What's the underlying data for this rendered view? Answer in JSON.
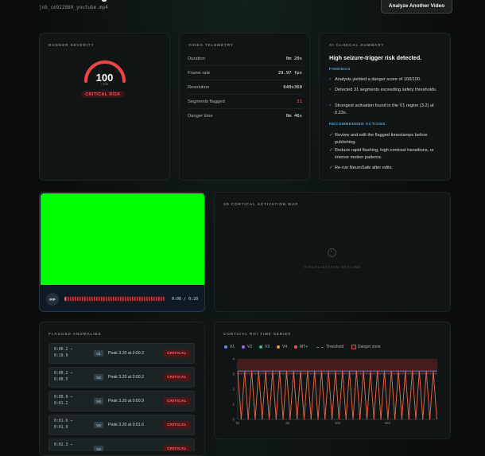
{
  "header": {
    "job_id": "job_ce922889_youtube.mp4",
    "analyze_button": "Analyze Another Video"
  },
  "severity": {
    "label": "DANGER SEVERITY",
    "score": "100",
    "max": "/ 100",
    "score_value": 100,
    "risk_badge": "CRITICAL RISK",
    "gauge_color": "#ef4444"
  },
  "telemetry": {
    "label": "VIDEO TELEMETRY",
    "rows": [
      {
        "key": "Duration",
        "value": "0m 20s"
      },
      {
        "key": "Frame rate",
        "value": "29.97 fps"
      },
      {
        "key": "Resolution",
        "value": "640x360"
      },
      {
        "key": "Segments flagged",
        "value": "31"
      },
      {
        "key": "Danger time",
        "value": "0m 46s"
      }
    ]
  },
  "summary": {
    "label": "AI CLINICAL SUMMARY",
    "headline": "High seizure-trigger risk detected.",
    "findings_label": "FINDINGS",
    "findings": [
      "Analysis yielded a danger score of 100/100.",
      "Detected 31 segments exceeding safety thresholds.",
      "Strongest activation found in the V1 region (3.2) at 0.23s."
    ],
    "actions_label": "RECOMMENDED ACTIONS",
    "actions": [
      "Review and edit the flagged timestamps before publishing.",
      "Reduce rapid flashing, high-contrast transitions, or intense motion patterns.",
      "Re-run NeuroSafe after edits."
    ]
  },
  "player": {
    "play_pause": "P/P",
    "time": "0:00 / 0:20",
    "progress": 0,
    "video_color": "#00ff00"
  },
  "cortical_map": {
    "label": "3D CORTICAL ACTIVATION MAP",
    "status": "VISUALIZATION OFFLINE"
  },
  "anomalies": {
    "label": "FLAGGED ANOMALIES",
    "items": [
      {
        "time": "0:00.2 → 0:19.9",
        "roi": "V1",
        "peak": "Peak 3.20 at 0:00.2",
        "badge": "CRITICAL"
      },
      {
        "time": "0:00.2 → 0:00.5",
        "roi": "V4",
        "peak": "Peak 3.20 at 0:00.2",
        "badge": "CRITICAL"
      },
      {
        "time": "0:00.9 → 0:01.2",
        "roi": "V4",
        "peak": "Peak 3.20 at 0:00.9",
        "badge": "CRITICAL"
      },
      {
        "time": "0:01.6 → 0:01.9",
        "roi": "V4",
        "peak": "Peak 3.20 at 0:01.6",
        "badge": "CRITICAL"
      },
      {
        "time": "0:02.3 →",
        "roi": "V4",
        "peak": "",
        "badge": "CRITICAL"
      }
    ]
  },
  "timeseries": {
    "label": "CORTICAL ROI TIME SERIES",
    "legend": [
      {
        "name": "V1",
        "color": "#4f8ff7"
      },
      {
        "name": "V2",
        "color": "#9b6cf0"
      },
      {
        "name": "V3",
        "color": "#2fc08b"
      },
      {
        "name": "V4",
        "color": "#f0a030"
      },
      {
        "name": "MT+",
        "color": "#e05a4a"
      },
      {
        "name": "Threshold",
        "color": "#6b7374"
      },
      {
        "name": "Danger zone",
        "color": "#d64545"
      }
    ]
  },
  "chart_data": {
    "type": "line",
    "title": "",
    "xlabel": "",
    "ylabel": "",
    "xlim": [
      0,
      20
    ],
    "ylim": [
      0,
      4
    ],
    "x_ticks": [
      "0s",
      "5s",
      "10s",
      "15s"
    ],
    "x_tick_values": [
      0,
      5,
      10,
      15
    ],
    "y_ticks": [
      "0",
      "1",
      "2",
      "3",
      "4"
    ],
    "threshold": 3,
    "grid": true,
    "legend_position": "top-left",
    "series": [
      {
        "name": "V1",
        "color": "#4f8ff7",
        "pattern": "flat",
        "level": 3.2
      },
      {
        "name": "V4",
        "color": "#f0a030",
        "pattern": "oscillating",
        "low": 0,
        "high": 3.2,
        "period": 0.7
      },
      {
        "name": "MT+",
        "color": "#e05a4a",
        "pattern": "oscillating",
        "low": 0,
        "high": 3.2,
        "period": 0.7
      }
    ]
  }
}
